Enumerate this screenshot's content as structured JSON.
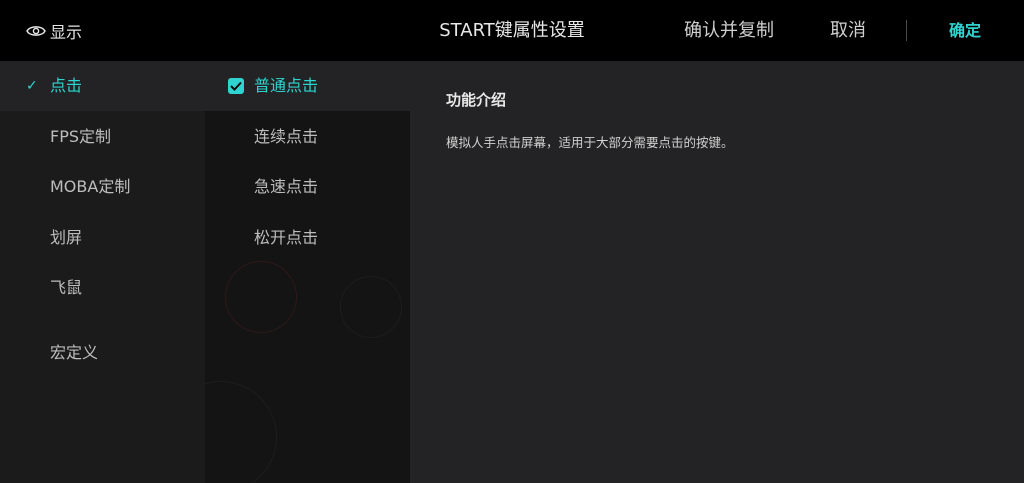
{
  "header": {
    "show_label": "显示",
    "title": "START键属性设置",
    "confirm_copy_label": "确认并复制",
    "cancel_label": "取消",
    "ok_label": "确定"
  },
  "categories": [
    {
      "label": "点击",
      "active": true
    },
    {
      "label": "FPS定制",
      "active": false
    },
    {
      "label": "MOBA定制",
      "active": false
    },
    {
      "label": "划屏",
      "active": false
    },
    {
      "label": "飞鼠",
      "active": false
    },
    {
      "label": "宏定义",
      "active": false
    }
  ],
  "subtypes": [
    {
      "label": "普通点击",
      "active": true
    },
    {
      "label": "连续点击",
      "active": false
    },
    {
      "label": "急速点击",
      "active": false
    },
    {
      "label": "松开点击",
      "active": false
    }
  ],
  "detail": {
    "title": "功能介绍",
    "description": "模拟人手点击屏幕，适用于大部分需要点击的按键。"
  },
  "colors": {
    "accent": "#2fd3d0",
    "topbar": "#000000",
    "panel": "#232325"
  }
}
